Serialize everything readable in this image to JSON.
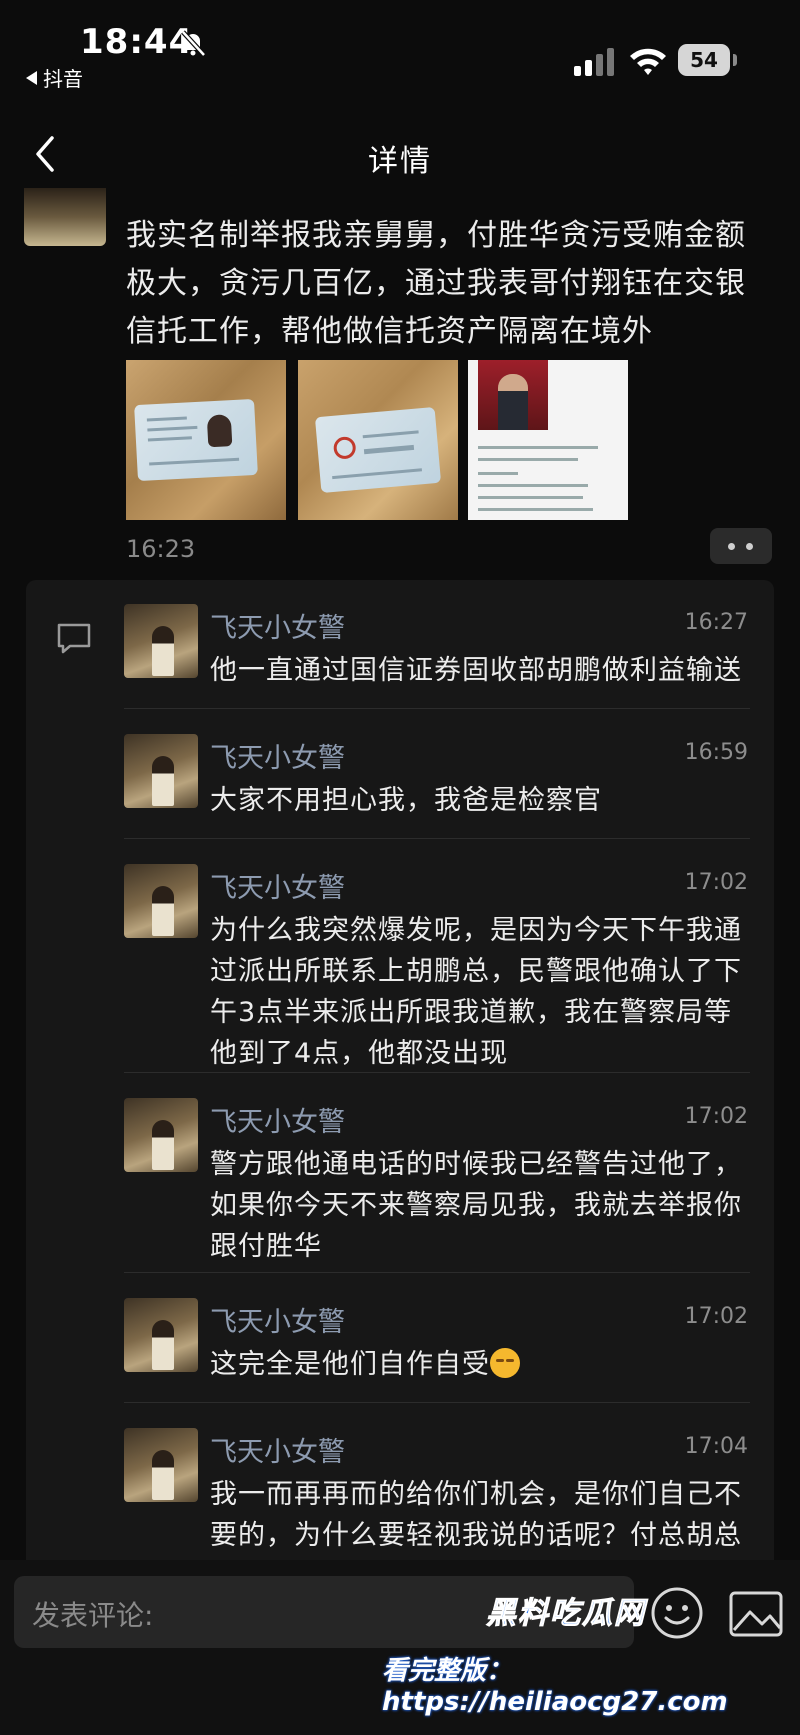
{
  "status_bar": {
    "time": "18:44",
    "back_app": "抖音",
    "battery": "54"
  },
  "nav": {
    "title": "详情"
  },
  "post": {
    "text": "我实名制举报我亲舅舅，付胜华贪污受贿金额极大，贪污几百亿，通过我表哥付翔钰在交银信托工作，帮他做信托资产隔离在境外",
    "time": "16:23"
  },
  "comments": [
    {
      "name": "飞天小女警",
      "time": "16:27",
      "text": "他一直通过国信证券固收部胡鹏做利益输送"
    },
    {
      "name": "飞天小女警",
      "time": "16:59",
      "text": "大家不用担心我，我爸是检察官"
    },
    {
      "name": "飞天小女警",
      "time": "17:02",
      "text": "为什么我突然爆发呢，是因为今天下午我通过派出所联系上胡鹏总，民警跟他确认了下午3点半来派出所跟我道歉，我在警察局等他到了4点，他都没出现"
    },
    {
      "name": "飞天小女警",
      "time": "17:02",
      "text": "警方跟他通电话的时候我已经警告过他了，如果你今天不来警察局见我，我就去举报你跟付胜华"
    },
    {
      "name": "飞天小女警",
      "time": "17:02",
      "text": "这完全是他们自作自受"
    },
    {
      "name": "飞天小女警",
      "time": "17:04",
      "text": "我一而再再而的给你们机会，是你们自己不要的，为什么要轻视我说的话呢？付总胡总"
    }
  ],
  "bottom": {
    "input_placeholder": "发表评论:"
  },
  "watermark": {
    "logo": "黑料吃瓜网",
    "url": "看完整版：https://heiliaocg27.com"
  },
  "icons": {
    "bell_muted": "bell-slash-icon",
    "signal": "signal-icon",
    "wifi": "wifi-icon",
    "back": "chevron-left-icon",
    "reply": "comment-icon",
    "more": "more-dots-icon",
    "emoji": "emoji-icon",
    "image": "image-icon"
  }
}
